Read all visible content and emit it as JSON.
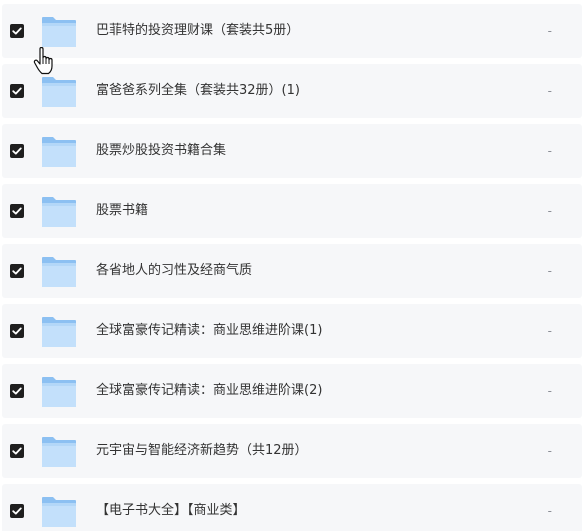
{
  "files": {
    "items": [
      {
        "name": "巴菲特的投资理财课（套装共5册）",
        "meta": "-",
        "checked": true
      },
      {
        "name": "富爸爸系列全集（套装共32册）(1)",
        "meta": "-",
        "checked": true
      },
      {
        "name": "股票炒股投资书籍合集",
        "meta": "-",
        "checked": true
      },
      {
        "name": "股票书籍",
        "meta": "-",
        "checked": true
      },
      {
        "name": "各省地人的习性及经商气质",
        "meta": "-",
        "checked": true
      },
      {
        "name": "全球富豪传记精读：商业思维进阶课(1)",
        "meta": "-",
        "checked": true
      },
      {
        "name": "全球富豪传记精读：商业思维进阶课(2)",
        "meta": "-",
        "checked": true
      },
      {
        "name": "元宇宙与智能经济新趋势（共12册）",
        "meta": "-",
        "checked": true
      },
      {
        "name": "【电子书大全】【商业类】",
        "meta": "-",
        "checked": true
      }
    ]
  },
  "icons": {
    "folder": "folder-icon",
    "checkbox": "checkbox-checked-icon",
    "cursor": "hand-pointer-cursor-icon"
  },
  "colors": {
    "row_background": "#f6f7f9",
    "folder_back": "#8cc0f2",
    "folder_front": "#c3e0fb",
    "checkbox": "#1f1f1f",
    "text": "#333333",
    "muted": "#8b8e96"
  }
}
